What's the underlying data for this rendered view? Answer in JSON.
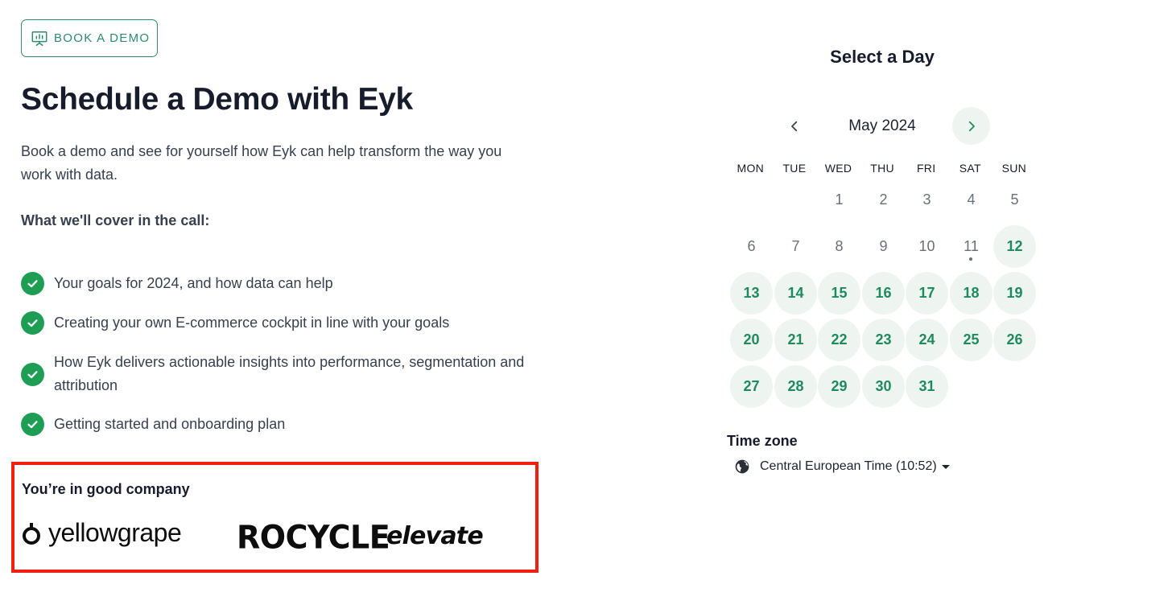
{
  "header": {
    "book_demo_label": "BOOK A DEMO",
    "book_demo_icon": "presentation-chart-icon",
    "title": "Schedule a Demo with Eyk",
    "intro": "Book a demo and see for yourself how Eyk can help transform the way you work with data."
  },
  "cover": {
    "heading": "What we'll cover in the call:",
    "items": [
      "Your goals for 2024, and how data can help",
      "Creating your own E-commerce cockpit in line with your goals",
      "How Eyk delivers actionable insights into performance, segmentation and attribution",
      "Getting started and onboarding plan"
    ]
  },
  "company": {
    "heading": "You’re in good company",
    "logos": [
      "yellowgrape",
      "ROCYCLE",
      "elevate"
    ]
  },
  "calendar": {
    "title": "Select a Day",
    "month_label": "May 2024",
    "weekdays": [
      "MON",
      "TUE",
      "WED",
      "THU",
      "FRI",
      "SAT",
      "SUN"
    ],
    "unavailable_days": [
      "1",
      "2",
      "3",
      "4",
      "5",
      "6",
      "7",
      "8",
      "9",
      "10",
      "11"
    ],
    "available_days": [
      "12",
      "13",
      "14",
      "15",
      "16",
      "17",
      "18",
      "19",
      "20",
      "21",
      "22",
      "23",
      "24",
      "25",
      "26",
      "27",
      "28",
      "29",
      "30",
      "31"
    ],
    "today_marker_day": "11"
  },
  "timezone": {
    "label": "Time zone",
    "value": "Central European Time (10:52)",
    "icon": "globe-icon"
  },
  "colors": {
    "accent_green": "#1e8a5e",
    "check_green": "#1e9e55",
    "available_bg": "#eef5f1",
    "highlight_border": "#f21f10"
  }
}
